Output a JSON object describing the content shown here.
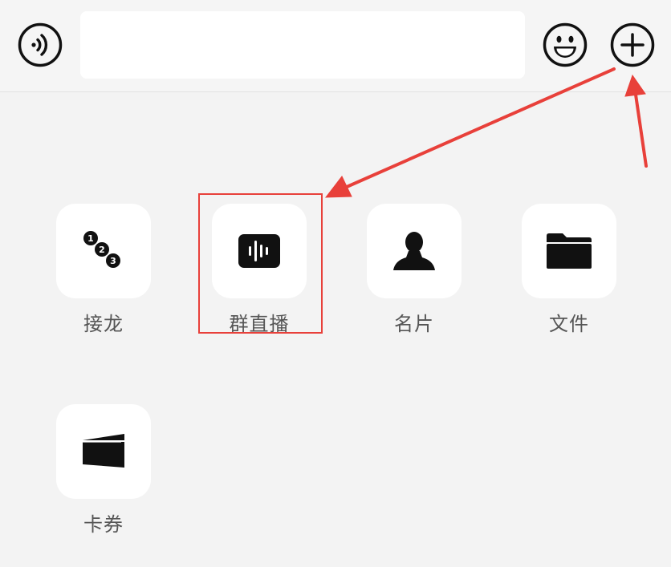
{
  "input_bar": {
    "message_value": "",
    "voice_icon": "voice-icon",
    "emoji_icon": "emoji-icon",
    "plus_icon": "plus-icon"
  },
  "tools": [
    {
      "id": "jielong",
      "label": "接龙",
      "icon": "numbered-dots-icon"
    },
    {
      "id": "live",
      "label": "群直播",
      "icon": "live-waveform-icon"
    },
    {
      "id": "card",
      "label": "名片",
      "icon": "contact-card-icon"
    },
    {
      "id": "file",
      "label": "文件",
      "icon": "folder-icon"
    },
    {
      "id": "coupon",
      "label": "卡券",
      "icon": "coupon-wallet-icon"
    }
  ],
  "annotation": {
    "color": "#e8403a"
  },
  "colors": {
    "background": "#f3f3f3",
    "tile": "#ffffff",
    "icon": "#111111",
    "label": "#555555"
  }
}
